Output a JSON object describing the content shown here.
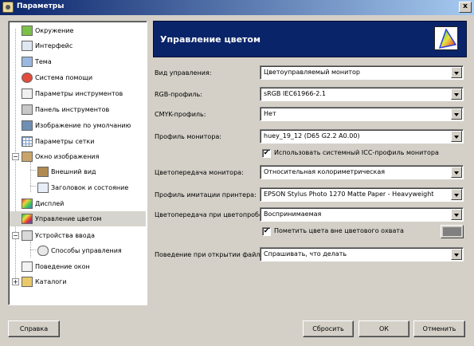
{
  "window": {
    "title": "Параметры",
    "close_glyph": "x"
  },
  "tree": {
    "items": [
      {
        "label": "Окружение",
        "icon": "environment-icon"
      },
      {
        "label": "Интерфейс",
        "icon": "interface-icon"
      },
      {
        "label": "Тема",
        "icon": "theme-icon"
      },
      {
        "label": "Система помощи",
        "icon": "help-system-icon"
      },
      {
        "label": "Параметры инструментов",
        "icon": "tool-options-icon"
      },
      {
        "label": "Панель инструментов",
        "icon": "toolbox-icon"
      },
      {
        "label": "Изображение по умолчанию",
        "icon": "default-image-icon"
      },
      {
        "label": "Параметры сетки",
        "icon": "grid-icon"
      },
      {
        "label": "Окно изображения",
        "icon": "image-window-icon",
        "expanded": true
      },
      {
        "label": "Внешний вид",
        "icon": "appearance-icon"
      },
      {
        "label": "Заголовок и состояние",
        "icon": "title-status-icon"
      },
      {
        "label": "Дисплей",
        "icon": "display-icon"
      },
      {
        "label": "Управление цветом",
        "icon": "color-management-icon",
        "selected": true
      },
      {
        "label": "Устройства ввода",
        "icon": "input-devices-icon",
        "expanded": true
      },
      {
        "label": "Способы управления",
        "icon": "input-controllers-icon"
      },
      {
        "label": "Поведение окон",
        "icon": "window-management-icon"
      },
      {
        "label": "Каталоги",
        "icon": "folders-icon",
        "expanded": false
      }
    ],
    "expander_minus": "−",
    "expander_plus": "+"
  },
  "panel": {
    "title": "Управление цветом",
    "fields": {
      "mode": {
        "label": "Вид управления:",
        "value": "Цветоуправляемый монитор"
      },
      "rgb": {
        "label": "RGB-профиль:",
        "value": "sRGB IEC61966-2.1"
      },
      "cmyk": {
        "label": "CMYK-профиль:",
        "value": "Нет"
      },
      "monitor": {
        "label": "Профиль монитора:",
        "value": "huey_19_12 (D65 G2.2 A0.00)"
      },
      "system_profile": {
        "label": "Использовать системный ICC-профиль монитора",
        "checked": true
      },
      "display_intent": {
        "label": "Цветопередача монитора:",
        "value": "Относительная колориметрическая"
      },
      "simulation": {
        "label": "Профиль имитации принтера:",
        "value": "EPSON Stylus Photo 1270 Matte Paper - Heavyweight"
      },
      "softproof_intent": {
        "label": "Цветопередача при цветопробе:",
        "value": "Воспринимаемая"
      },
      "gamut_check": {
        "label": "Пометить цвета вне цветового охвата",
        "checked": true,
        "color": "#808080"
      },
      "open_behavior": {
        "label": "Поведение при открытии файла:",
        "value": "Спрашивать, что делать"
      }
    },
    "check_glyph": "✔"
  },
  "buttons": {
    "help": "Справка",
    "reset": "Сбросить",
    "ok": "ОК",
    "cancel": "Отменить"
  }
}
